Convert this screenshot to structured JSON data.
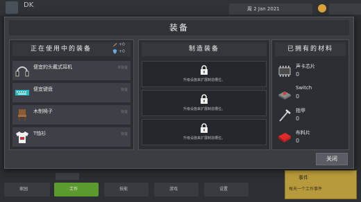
{
  "background": {
    "player_name": "DK",
    "date_text": "周 2 Jan 2021",
    "bottom_buttons": [
      "家园",
      "工作",
      "技能",
      "游戏",
      "设置"
    ],
    "tile_title": "事件",
    "tile_desc": "每天一个工作事件"
  },
  "modal": {
    "title": "装备",
    "close_label": "关闭"
  },
  "equipped": {
    "header": "正在使用中的装备",
    "stats": [
      {
        "icon": "sword-icon",
        "value": "+0"
      },
      {
        "icon": "shield-icon",
        "value": "+0"
      }
    ],
    "items": [
      {
        "label": "便宜的头戴式耳机",
        "tag": "未装备",
        "icon": "headphones-icon"
      },
      {
        "label": "便宜键盘",
        "tag": "装备",
        "icon": "keyboard-icon"
      },
      {
        "label": "木制椅子",
        "tag": "装备",
        "icon": "chair-icon"
      },
      {
        "label": "T恤衫",
        "tag": "装备",
        "icon": "tshirt-icon"
      }
    ]
  },
  "crafting": {
    "header": "制造装备",
    "slots": [
      {
        "text": "升级设施来扩展制造槽位。"
      },
      {
        "text": "升级设施来扩展制造槽位。"
      },
      {
        "text": "升级设施来扩展制造槽位。"
      }
    ]
  },
  "materials": {
    "header": "已拥有的材料",
    "items": [
      {
        "name": "声卡芯片",
        "count": "0",
        "icon": "chip-icon"
      },
      {
        "name": "Switch",
        "count": "0",
        "icon": "switch-icon"
      },
      {
        "name": "指甲",
        "count": "0",
        "icon": "nail-icon"
      },
      {
        "name": "布料片",
        "count": "0",
        "icon": "fabric-icon"
      }
    ]
  }
}
